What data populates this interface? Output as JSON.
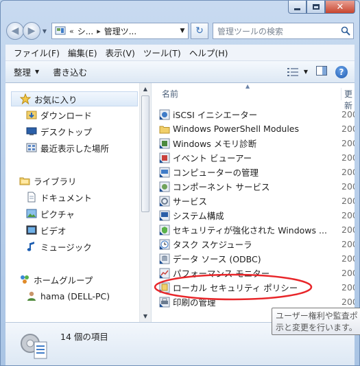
{
  "window": {
    "close_glyph": "✕"
  },
  "address_bar": {
    "overflow_glyph": "«",
    "crumbs": [
      "シ...",
      "管理ツ..."
    ],
    "search_placeholder": "管理ツールの検索"
  },
  "menu": {
    "items": [
      "ファイル(F)",
      "編集(E)",
      "表示(V)",
      "ツール(T)",
      "ヘルプ(H)"
    ]
  },
  "commands": {
    "organize": "整理",
    "burn": "書き込む",
    "help_glyph": "?"
  },
  "nav_pane": {
    "favorites": "お気に入り",
    "downloads": "ダウンロード",
    "desktop": "デスクトップ",
    "recent": "最近表示した場所",
    "libraries": "ライブラリ",
    "documents": "ドキュメント",
    "pictures": "ピクチャ",
    "videos": "ビデオ",
    "music": "ミュージック",
    "homegroup": "ホームグループ",
    "homegroup_user": "hama (DELL-PC)"
  },
  "file_list": {
    "col_name": "名前",
    "col_date": "更新",
    "items": [
      {
        "name": "iSCSI イニシエーター",
        "date": "200"
      },
      {
        "name": "Windows PowerShell Modules",
        "date": "200"
      },
      {
        "name": "Windows メモリ診断",
        "date": "200"
      },
      {
        "name": "イベント ビューアー",
        "date": "200"
      },
      {
        "name": "コンピューターの管理",
        "date": "200"
      },
      {
        "name": "コンポーネント サービス",
        "date": "200"
      },
      {
        "name": "サービス",
        "date": "200"
      },
      {
        "name": "システム構成",
        "date": "200"
      },
      {
        "name": "セキュリティが強化された Windows ...",
        "date": "200"
      },
      {
        "name": "タスク スケジューラ",
        "date": "200"
      },
      {
        "name": "データ ソース (ODBC)",
        "date": "200"
      },
      {
        "name": "パフォーマンス モニター",
        "date": "200"
      },
      {
        "name": "ローカル セキュリティ ポリシー",
        "date": "200"
      },
      {
        "name": "印刷の管理",
        "date": "200"
      }
    ]
  },
  "status": {
    "count": "14 個の項目"
  },
  "tooltip": {
    "line1": "ユーザー権利や監査ポ",
    "line2": "示と変更を行います。"
  },
  "colors": {
    "annotation": "#e8262a",
    "accent": "#1f5bb0"
  }
}
